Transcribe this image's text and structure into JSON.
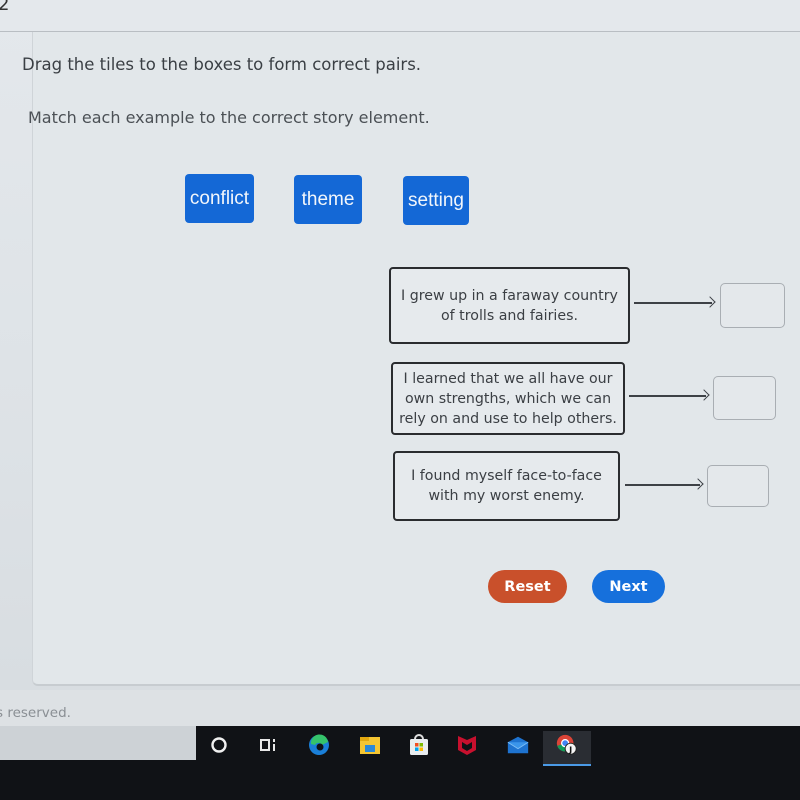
{
  "question": {
    "number": "2",
    "instruction": "Drag the tiles to the boxes to form correct pairs.",
    "subinstruction": "Match each example to the correct story element."
  },
  "tiles": [
    {
      "label": "conflict"
    },
    {
      "label": "theme"
    },
    {
      "label": "setting"
    }
  ],
  "pairs": [
    {
      "example": "I grew up in a faraway country of trolls and fairies.",
      "answer": ""
    },
    {
      "example": "I learned that we all have our own strengths, which we can rely on and use to help others.",
      "answer": ""
    },
    {
      "example": "I found myself face-to-face with my worst enemy.",
      "answer": ""
    }
  ],
  "buttons": {
    "reset": "Reset",
    "next": "Next"
  },
  "footer": {
    "copyright": "s reserved."
  },
  "taskbar": {
    "icons": [
      "search-circle-icon",
      "task-view-icon",
      "edge-icon",
      "file-explorer-icon",
      "microsoft-store-icon",
      "mcafee-icon",
      "mail-icon",
      "chrome-profile-icon"
    ],
    "active": "chrome-profile-icon"
  },
  "colors": {
    "tile": "#1468d6",
    "reset": "#c9502b",
    "next": "#1670dc"
  }
}
